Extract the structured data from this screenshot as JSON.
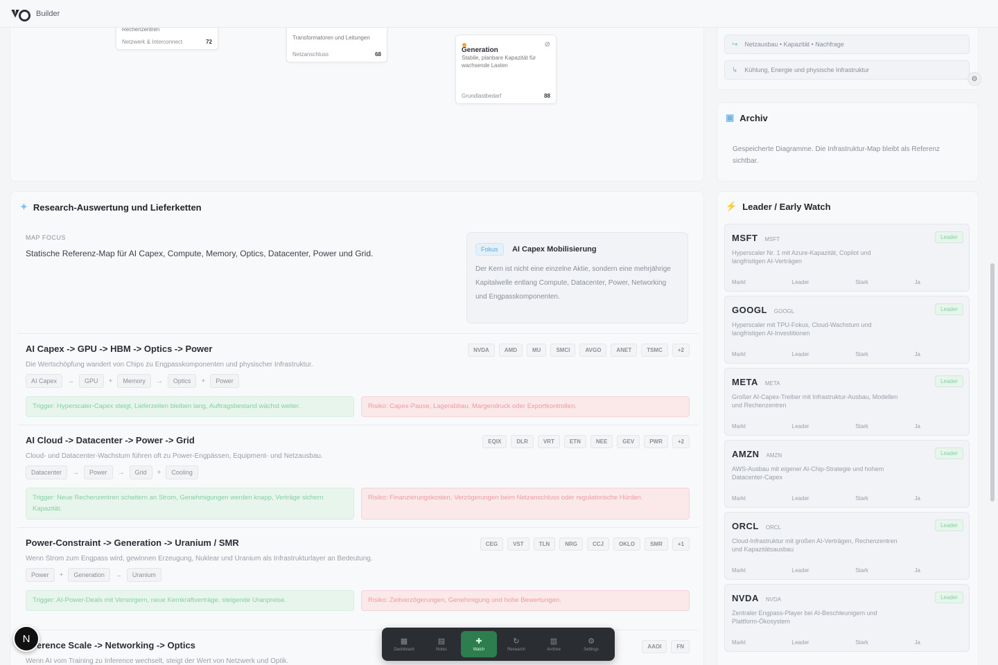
{
  "app": {
    "title": "Builder"
  },
  "flow": {
    "nodes": [
      {
        "sub": "Rechenzentren",
        "meta_left": "Netzwerk & Interconnect",
        "meta_right": "72"
      },
      {
        "sub": "Transformatoren und Leitungen",
        "meta_left": "Netzanschluss",
        "meta_right": "68"
      },
      {
        "title": "Generation",
        "sub": "Stabile, planbare Kapazität für wachsende Lasten",
        "meta_left": "Grundlastbedarf",
        "meta_right": "88"
      }
    ]
  },
  "notes": [
    {
      "icon": "↪",
      "text": "Netzausbau • Kapazität • Nachfrage"
    },
    {
      "icon": "↳",
      "text": "Kühlung, Energie und physische Infrastruktur"
    }
  ],
  "archive": {
    "title": "Archiv",
    "body": "Gespeicherte Diagramme. Die Infrastruktur-Map bleibt als Referenz sichtbar."
  },
  "research": {
    "title": "Research-Auswertung und Lieferketten",
    "overline": "MAP FOCUS",
    "lead": "Statische Referenz-Map für AI Capex, Compute, Memory, Optics, Datacenter, Power und Grid.",
    "focus": {
      "pill": "Fokus",
      "title": "AI Capex Mobilisierung",
      "body": "Der Kern ist nicht eine einzelne Aktie, sondern eine mehrjährige Kapitalwelle entlang Compute, Datacenter, Power, Networking und Engpasskomponenten."
    },
    "chains": [
      {
        "title": "AI Capex -> GPU -> HBM -> Optics -> Power",
        "desc": "Die Wertschöpfung wandert von Chips zu Engpasskomponenten und physischer Infrastruktur.",
        "tickers": [
          "NVDA",
          "AMD",
          "MU",
          "SMCI",
          "AVGO",
          "ANET",
          "TSMC",
          "+2"
        ],
        "chips": [
          "AI Capex",
          "GPU",
          "Memory",
          "Optics",
          "Power"
        ],
        "ops": [
          "→",
          "+",
          "→",
          "+"
        ],
        "trigger": "Trigger: Hyperscaler-Capex steigt, Lieferzeiten bleiben lang, Auftragsbestand wächst weiter.",
        "risk": "Risiko: Capex-Pause, Lagerabbau, Margendruck oder Exportkontrollen."
      },
      {
        "title": "AI Cloud -> Datacenter -> Power -> Grid",
        "desc": "Cloud- und Datacenter-Wachstum führen oft zu Power-Engpässen, Equipment- und Netzausbau.",
        "tickers": [
          "EQIX",
          "DLR",
          "VRT",
          "ETN",
          "NEE",
          "GEV",
          "PWR",
          "+2"
        ],
        "chips": [
          "Datacenter",
          "Power",
          "Grid",
          "Cooling"
        ],
        "ops": [
          "→",
          "→",
          "+"
        ],
        "trigger": "Trigger: Neue Rechenzentren scheitern an Strom, Genehmigungen werden knapp, Verträge sichern Kapazität.",
        "risk": "Risiko: Finanzierungskosten, Verzögerungen beim Netzanschluss oder regulatorische Hürden."
      },
      {
        "title": "Power-Constraint -> Generation -> Uranium / SMR",
        "desc": "Wenn Strom zum Engpass wird, gewinnen Erzeugung, Nuklear und Uranium als Infrastrukturlayer an Bedeutung.",
        "tickers": [
          "CEG",
          "VST",
          "TLN",
          "NRG",
          "CCJ",
          "OKLO",
          "SMR",
          "+1"
        ],
        "chips": [
          "Power",
          "Generation",
          "Uranium"
        ],
        "ops": [
          "+",
          "→"
        ],
        "trigger": "Trigger: AI-Power-Deals mit Versorgern, neue Kernkraftverträge, steigende Uranpreise.",
        "risk": "Risiko: Zeitverzögerungen, Genehmigung und hohe Bewertungen."
      },
      {
        "title": "Inference Scale -> Networking -> Optics",
        "desc": "Wenn AI vom Training zu Inference wechselt, steigt der Wert von Netzwerk und Optik.",
        "tickers": [
          "AAOI",
          "FN"
        ],
        "chips": [],
        "ops": [],
        "trigger": "",
        "risk": ""
      }
    ]
  },
  "leaders": {
    "title": "Leader / Early Watch",
    "items": [
      {
        "ticker": "MSFT",
        "name": "MSFT",
        "badge": "Leader",
        "desc": "Hyperscaler Nr. 1 mit Azure-Kapazität, Copilot und langfristigen AI-Verträgen",
        "stats": [
          "Markt",
          "Leader",
          "Stark",
          "Ja"
        ]
      },
      {
        "ticker": "GOOGL",
        "name": "GOOGL",
        "badge": "Leader",
        "desc": "Hyperscaler mit TPU-Fokus, Cloud-Wachstum und langfristigen AI-Investitionen",
        "stats": [
          "Markt",
          "Leader",
          "Stark",
          "Ja"
        ]
      },
      {
        "ticker": "META",
        "name": "META",
        "badge": "Leader",
        "desc": "Großer AI-Capex-Treiber mit Infrastruktur-Ausbau, Modellen und Rechenzentren",
        "stats": [
          "Markt",
          "Leader",
          "Stark",
          "Ja"
        ]
      },
      {
        "ticker": "AMZN",
        "name": "AMZN",
        "badge": "Leader",
        "desc": "AWS-Ausbau mit eigener AI-Chip-Strategie und hohem Datacenter-Capex",
        "stats": [
          "Markt",
          "Leader",
          "Stark",
          "Ja"
        ]
      },
      {
        "ticker": "ORCL",
        "name": "ORCL",
        "badge": "Leader",
        "desc": "Cloud-Infrastruktur mit großen AI-Verträgen, Rechenzentren und Kapazitätsausbau",
        "stats": [
          "Markt",
          "Leader",
          "Stark",
          "Ja"
        ]
      },
      {
        "ticker": "NVDA",
        "name": "NVDA",
        "badge": "Leader",
        "desc": "Zentraler Engpass-Player bei AI-Beschleunigern und Plattform-Ökosystem",
        "stats": [
          "Markt",
          "Leader",
          "Stark",
          "Ja"
        ]
      }
    ]
  },
  "dock": {
    "items": [
      {
        "icon": "▦",
        "label": "Dashboard"
      },
      {
        "icon": "▤",
        "label": "Notes"
      },
      {
        "icon": "✚",
        "label": "Watch"
      },
      {
        "icon": "↻",
        "label": "Research"
      },
      {
        "icon": "▥",
        "label": "Archive"
      },
      {
        "icon": "⚙",
        "label": "Settings"
      }
    ],
    "active_index": 2
  },
  "avatar": {
    "letter": "N"
  },
  "side_button_icon": "⚙"
}
